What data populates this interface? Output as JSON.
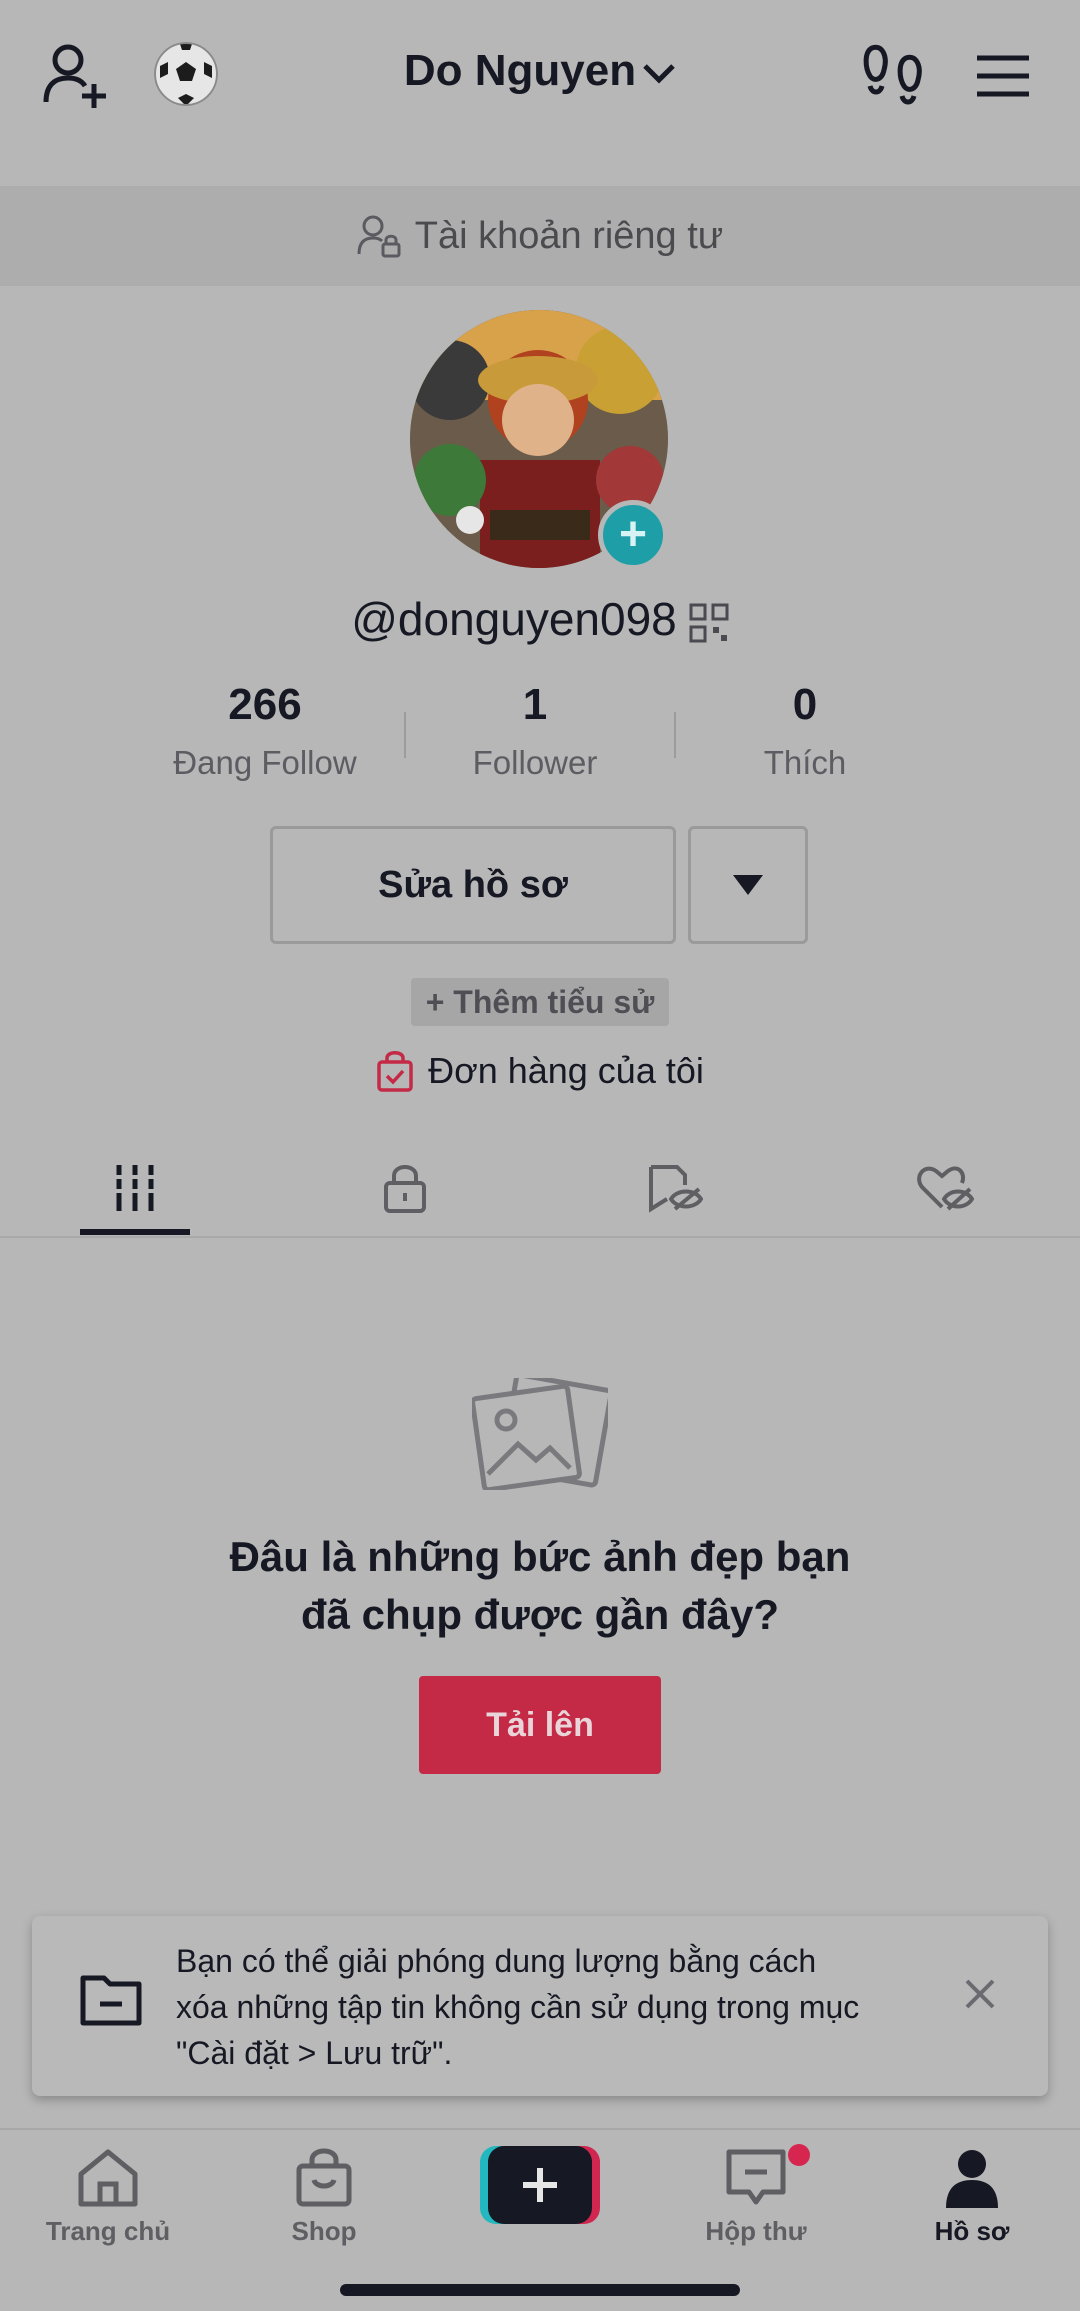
{
  "header": {
    "title": "Do Nguyen",
    "icons": [
      "add-user-icon",
      "soccer-ball-icon",
      "chevron-down-icon",
      "footprints-icon",
      "menu-icon"
    ]
  },
  "private_banner": {
    "text": "Tài khoản riêng tư",
    "icon": "private-account-icon"
  },
  "profile": {
    "handle": "@donguyen098",
    "stats": [
      {
        "value": "266",
        "label": "Đang Follow"
      },
      {
        "value": "1",
        "label": "Follower"
      },
      {
        "value": "0",
        "label": "Thích"
      }
    ],
    "edit_button": "Sửa hồ sơ",
    "add_bio": "+ Thêm tiểu sử",
    "orders": "Đơn hàng của tôi"
  },
  "tabs": [
    {
      "icon": "grid-videos-icon",
      "active": true
    },
    {
      "icon": "lock-icon",
      "active": false
    },
    {
      "icon": "hidden-posts-icon",
      "active": false
    },
    {
      "icon": "liked-hidden-icon",
      "active": false
    }
  ],
  "empty_state": {
    "line1": "Đâu là những bức ảnh đẹp bạn",
    "line2": "đã chụp được gần đây?",
    "button": "Tải lên"
  },
  "toast": {
    "line1": "Bạn có thể giải phóng dung lượng bằng cách",
    "line2": "xóa những tập tin không cần sử dụng trong mục",
    "line3": "\"Cài đặt > Lưu trữ\"."
  },
  "bottom_nav": {
    "home": "Trang chủ",
    "shop": "Shop",
    "inbox": "Hộp thư",
    "profile": "Hồ sơ"
  },
  "colors": {
    "accent": "#c42a46",
    "badge": "#d62650",
    "avatar_add": "#1e9fa7"
  }
}
